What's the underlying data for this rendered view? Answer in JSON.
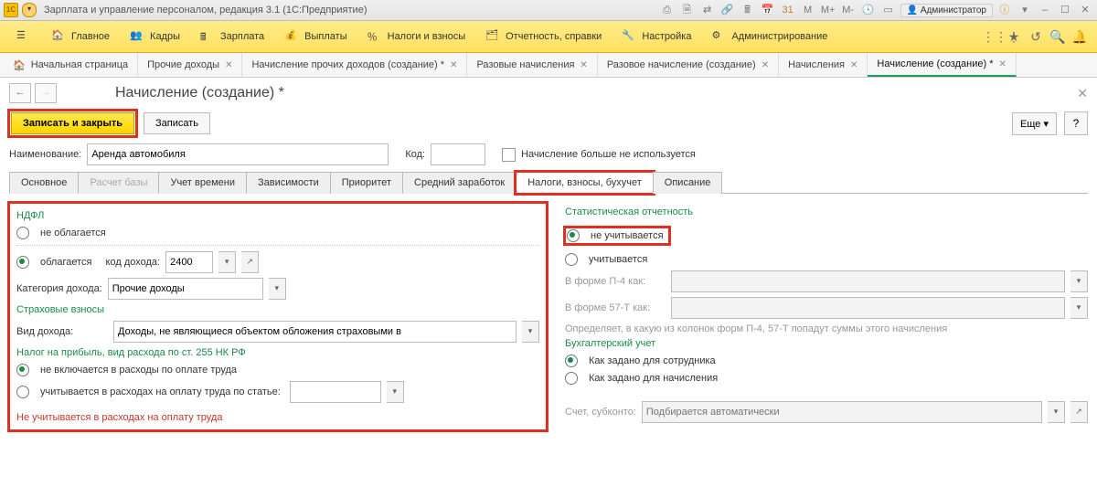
{
  "titlebar": {
    "app_icon": "1C",
    "title": "Зарплата и управление персоналом, редакция 3.1  (1С:Предприятие)",
    "user_label": "Администратор",
    "m_labels": [
      "M",
      "M+",
      "M-"
    ]
  },
  "menu": {
    "items": [
      {
        "label": "Главное",
        "icon": "home"
      },
      {
        "label": "Кадры",
        "icon": "people"
      },
      {
        "label": "Зарплата",
        "icon": "calc"
      },
      {
        "label": "Выплаты",
        "icon": "money"
      },
      {
        "label": "Налоги и взносы",
        "icon": "percent"
      },
      {
        "label": "Отчетность, справки",
        "icon": "report"
      },
      {
        "label": "Настройка",
        "icon": "wrench"
      },
      {
        "label": "Администрирование",
        "icon": "gear"
      }
    ]
  },
  "navtabs": [
    {
      "label": "Начальная страница",
      "closable": false,
      "home": true
    },
    {
      "label": "Прочие доходы",
      "closable": true
    },
    {
      "label": "Начисление прочих доходов (создание) *",
      "closable": true
    },
    {
      "label": "Разовые начисления",
      "closable": true
    },
    {
      "label": "Разовое начисление (создание)",
      "closable": true
    },
    {
      "label": "Начисления",
      "closable": true
    },
    {
      "label": "Начисление (создание) *",
      "closable": true,
      "active": true
    }
  ],
  "page": {
    "title": "Начисление (создание) *",
    "save_close": "Записать и закрыть",
    "save": "Записать",
    "more": "Еще",
    "q": "?",
    "name_label": "Наименование:",
    "name_value": "Аренда автомобиля",
    "code_label": "Код:",
    "code_value": "",
    "unused_label": "Начисление больше не используется"
  },
  "subtabs": [
    {
      "label": "Основное"
    },
    {
      "label": "Расчет базы",
      "disabled": true
    },
    {
      "label": "Учет времени"
    },
    {
      "label": "Зависимости"
    },
    {
      "label": "Приоритет"
    },
    {
      "label": "Средний заработок"
    },
    {
      "label": "Налоги, взносы, бухучет",
      "active": true
    },
    {
      "label": "Описание"
    }
  ],
  "left": {
    "ndfl_title": "НДФЛ",
    "ndfl_opt1": "не облагается",
    "ndfl_opt2": "облагается",
    "income_code_label": "код дохода:",
    "income_code_value": "2400",
    "income_cat_label": "Категория дохода:",
    "income_cat_value": "Прочие доходы",
    "ins_title": "Страховые взносы",
    "ins_kind_label": "Вид дохода:",
    "ins_kind_value": "Доходы, не являющиеся объектом обложения страховыми в",
    "profit_title": "Налог на прибыль, вид расхода по ст. 255 НК РФ",
    "profit_opt1": "не включается в расходы по оплате труда",
    "profit_opt2": "учитывается в расходах на оплату труда по статье:",
    "profit_article_value": "",
    "warn": "Не учитывается в расходах на оплату труда"
  },
  "right": {
    "stat_title": "Статистическая отчетность",
    "stat_opt1": "не учитывается",
    "stat_opt2": "учитывается",
    "p4_label": "В форме П-4 как:",
    "p4_value": "",
    "p57_label": "В форме 57-Т как:",
    "p57_value": "",
    "hint": "Определяет, в какую из колонок форм П-4, 57-Т попадут суммы этого начисления",
    "acc_title": "Бухгалтерский учет",
    "acc_opt1": "Как задано для сотрудника",
    "acc_opt2": "Как задано для начисления",
    "account_label": "Счет, субконто:",
    "account_placeholder": "Подбирается автоматически"
  }
}
